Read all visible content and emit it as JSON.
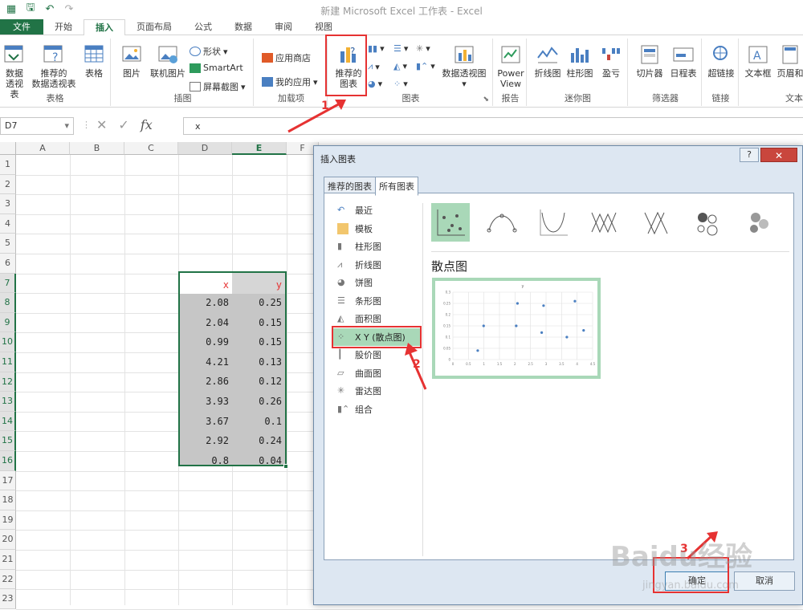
{
  "window": {
    "title": "新建 Microsoft Excel 工作表 - Excel"
  },
  "ribbon": {
    "tabs": [
      "文件",
      "开始",
      "插入",
      "页面布局",
      "公式",
      "数据",
      "审阅",
      "视图"
    ],
    "active_tab": "插入",
    "groups": {
      "tables": {
        "label": "表格",
        "pivot": "数据\n透视表",
        "rec_pivot": "推荐的\n数据透视表",
        "table": "表格"
      },
      "illustrations": {
        "label": "插图",
        "pictures": "图片",
        "online_pictures": "联机图片",
        "shapes": "形状",
        "smartart": "SmartArt",
        "screenshot": "屏幕截图"
      },
      "addins": {
        "label": "加载项",
        "store": "应用商店",
        "myapps": "我的应用"
      },
      "charts": {
        "label": "图表",
        "recommended": "推荐的\n图表",
        "pivotchart": "数据透视图"
      },
      "reports": {
        "label": "报告",
        "powerview": "Power\nView"
      },
      "sparklines": {
        "label": "迷你图",
        "line": "折线图",
        "column": "柱形图",
        "winloss": "盈亏"
      },
      "filters": {
        "label": "筛选器",
        "slicer": "切片器",
        "timeline": "日程表"
      },
      "links": {
        "label": "链接",
        "hyperlink": "超链接"
      },
      "text": {
        "label": "文本",
        "textbox": "文本框",
        "header": "页眉和"
      }
    }
  },
  "formula_bar": {
    "name_box": "D7",
    "formula": "x"
  },
  "sheet": {
    "columns": [
      "A",
      "B",
      "C",
      "D",
      "E",
      "F"
    ],
    "rows": [
      "1",
      "2",
      "3",
      "4",
      "5",
      "6",
      "7",
      "8",
      "9",
      "10",
      "11",
      "12",
      "13",
      "14",
      "15",
      "16",
      "17",
      "18",
      "19",
      "20",
      "21",
      "22",
      "23"
    ],
    "header_x": "x",
    "header_y": "y",
    "x_values": [
      "2.08",
      "2.04",
      "0.99",
      "4.21",
      "2.86",
      "3.93",
      "3.67",
      "2.92",
      "0.8"
    ],
    "y_values": [
      "0.25",
      "0.15",
      "0.15",
      "0.13",
      "0.12",
      "0.26",
      "0.1",
      "0.24",
      "0.04"
    ]
  },
  "dialog": {
    "title": "插入图表",
    "help": "?",
    "close": "✕",
    "tabs": [
      "推荐的图表",
      "所有图表"
    ],
    "active_tab": "所有图表",
    "chart_types": [
      "最近",
      "模板",
      "柱形图",
      "折线图",
      "饼图",
      "条形图",
      "面积图",
      "X Y (散点图)",
      "股价图",
      "曲面图",
      "雷达图",
      "组合"
    ],
    "selected_type": "X Y (散点图)",
    "subtype_title": "散点图",
    "ok": "确定",
    "cancel": "取消"
  },
  "chart_data": {
    "type": "scatter",
    "title": "y",
    "x": [
      2.08,
      2.04,
      0.99,
      4.21,
      2.86,
      3.93,
      3.67,
      2.92,
      0.8
    ],
    "y": [
      0.25,
      0.15,
      0.15,
      0.13,
      0.12,
      0.26,
      0.1,
      0.24,
      0.04
    ],
    "xlim": [
      0,
      4.5
    ],
    "ylim": [
      0,
      0.3
    ],
    "xticks": [
      "0",
      "0.5",
      "1",
      "1.5",
      "2",
      "2.5",
      "3",
      "3.5",
      "4",
      "4.5"
    ],
    "yticks": [
      "0.3",
      "0.25",
      "0.2",
      "0.15",
      "0.1",
      "0.05",
      "0"
    ],
    "grid": true,
    "color": "#4a7fc1"
  },
  "annotations": {
    "step1": "1",
    "step2": "2",
    "step3": "3",
    "color": "#e63232"
  },
  "watermark": {
    "brand": "Baidu经验",
    "url": "jingyan.baidu.com"
  }
}
